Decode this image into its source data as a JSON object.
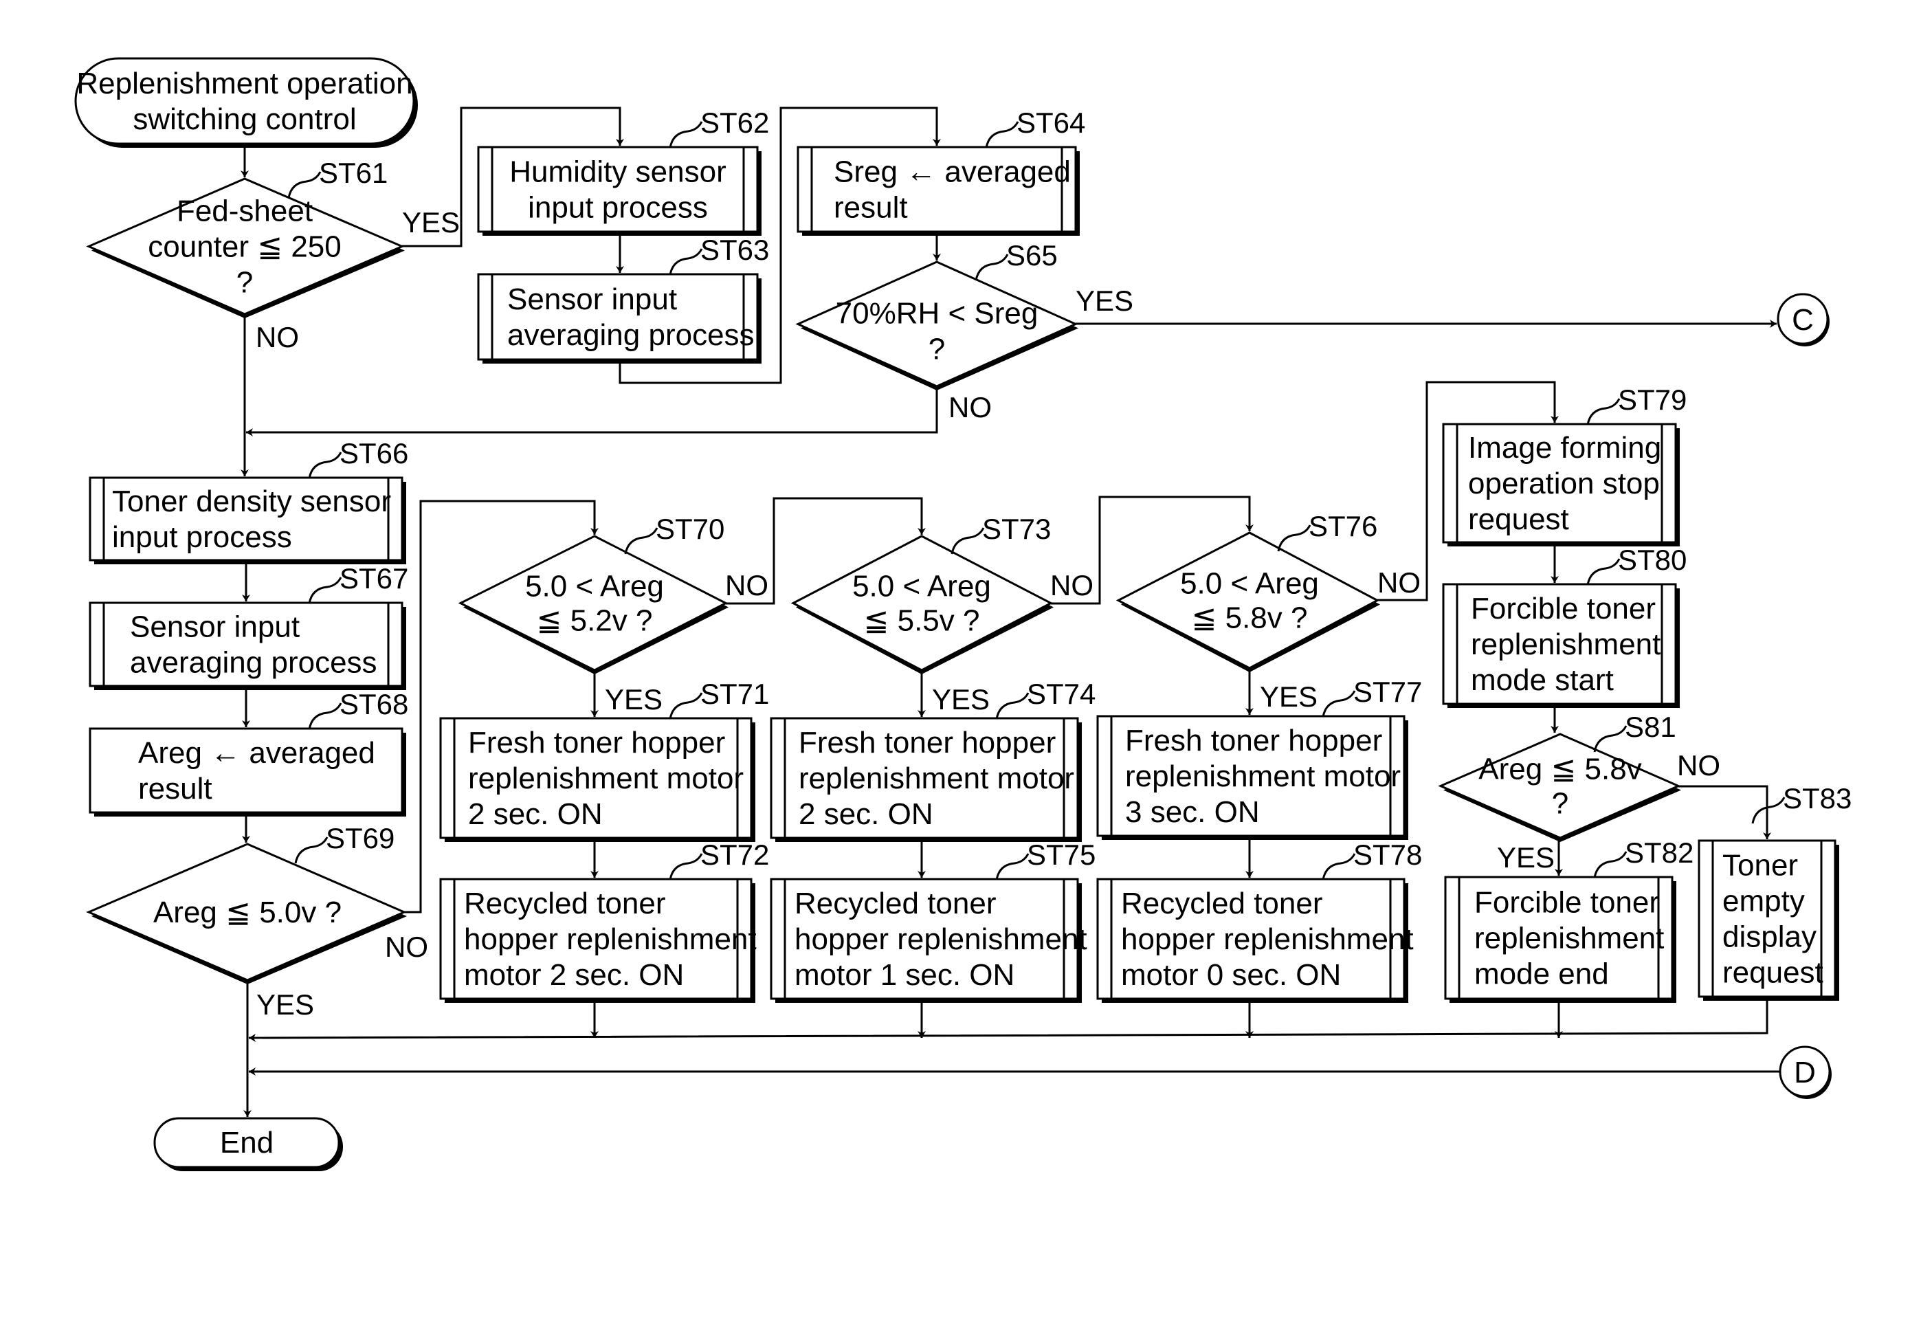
{
  "title": "Replenishment operation switching control flowchart",
  "start": {
    "lines": [
      "Replenishment operation",
      "switching control"
    ]
  },
  "end": {
    "label": "End"
  },
  "connectors": {
    "c": "C",
    "d": "D"
  },
  "nodes": {
    "ST61": {
      "id": "ST61",
      "type": "decision",
      "lines": [
        "Fed-sheet",
        "counter ≦ 250",
        "?"
      ],
      "yes": "YES",
      "no": "NO"
    },
    "ST62": {
      "id": "ST62",
      "type": "process",
      "lines": [
        "Humidity sensor",
        "input process"
      ]
    },
    "ST63": {
      "id": "ST63",
      "type": "process",
      "lines": [
        "Sensor input",
        "averaging process"
      ]
    },
    "ST64": {
      "id": "ST64",
      "type": "process",
      "lines": [
        "Sreg ← averaged",
        "result"
      ]
    },
    "S65": {
      "id": "S65",
      "type": "decision",
      "lines": [
        "70%RH < Sreg",
        "?"
      ],
      "yes": "YES",
      "no": "NO"
    },
    "ST66": {
      "id": "ST66",
      "type": "process",
      "lines": [
        "Toner density sensor",
        "input process"
      ]
    },
    "ST67": {
      "id": "ST67",
      "type": "process",
      "lines": [
        "Sensor input",
        "averaging process"
      ]
    },
    "ST68": {
      "id": "ST68",
      "type": "assign",
      "lines": [
        "Areg ← averaged",
        "result"
      ]
    },
    "ST69": {
      "id": "ST69",
      "type": "decision",
      "lines": [
        "Areg ≦ 5.0v ?"
      ],
      "yes": "YES",
      "no": "NO"
    },
    "ST70": {
      "id": "ST70",
      "type": "decision",
      "lines": [
        "5.0 < Areg",
        "≦ 5.2v ?"
      ],
      "yes": "YES",
      "no": "NO"
    },
    "ST71": {
      "id": "ST71",
      "type": "process",
      "lines": [
        "Fresh toner hopper",
        "replenishment motor",
        "2 sec. ON"
      ]
    },
    "ST72": {
      "id": "ST72",
      "type": "process",
      "lines": [
        "Recycled toner",
        "hopper replenishment",
        "motor 2 sec. ON"
      ]
    },
    "ST73": {
      "id": "ST73",
      "type": "decision",
      "lines": [
        "5.0 < Areg",
        "≦ 5.5v ?"
      ],
      "yes": "YES",
      "no": "NO"
    },
    "ST74": {
      "id": "ST74",
      "type": "process",
      "lines": [
        "Fresh toner hopper",
        "replenishment motor",
        "2 sec. ON"
      ]
    },
    "ST75": {
      "id": "ST75",
      "type": "process",
      "lines": [
        "Recycled toner",
        "hopper replenishment",
        "motor 1 sec. ON"
      ]
    },
    "ST76": {
      "id": "ST76",
      "type": "decision",
      "lines": [
        "5.0 < Areg",
        "≦ 5.8v ?"
      ],
      "yes": "YES",
      "no": "NO"
    },
    "ST77": {
      "id": "ST77",
      "type": "process",
      "lines": [
        "Fresh toner hopper",
        "replenishment motor",
        "3 sec. ON"
      ]
    },
    "ST78": {
      "id": "ST78",
      "type": "process",
      "lines": [
        "Recycled toner",
        "hopper replenishment",
        "motor 0 sec. ON"
      ]
    },
    "ST79": {
      "id": "ST79",
      "type": "process",
      "lines": [
        "Image forming",
        "operation stop",
        "request"
      ]
    },
    "ST80": {
      "id": "ST80",
      "type": "process",
      "lines": [
        "Forcible toner",
        "replenishment",
        "mode start"
      ]
    },
    "S81": {
      "id": "S81",
      "type": "decision",
      "lines": [
        "Areg ≦ 5.8v",
        "?"
      ],
      "yes": "YES",
      "no": "NO"
    },
    "ST82": {
      "id": "ST82",
      "type": "process",
      "lines": [
        "Forcible toner",
        "replenishment",
        "mode end"
      ]
    },
    "ST83": {
      "id": "ST83",
      "type": "process",
      "lines": [
        "Toner",
        "empty",
        "display",
        "request"
      ]
    }
  }
}
